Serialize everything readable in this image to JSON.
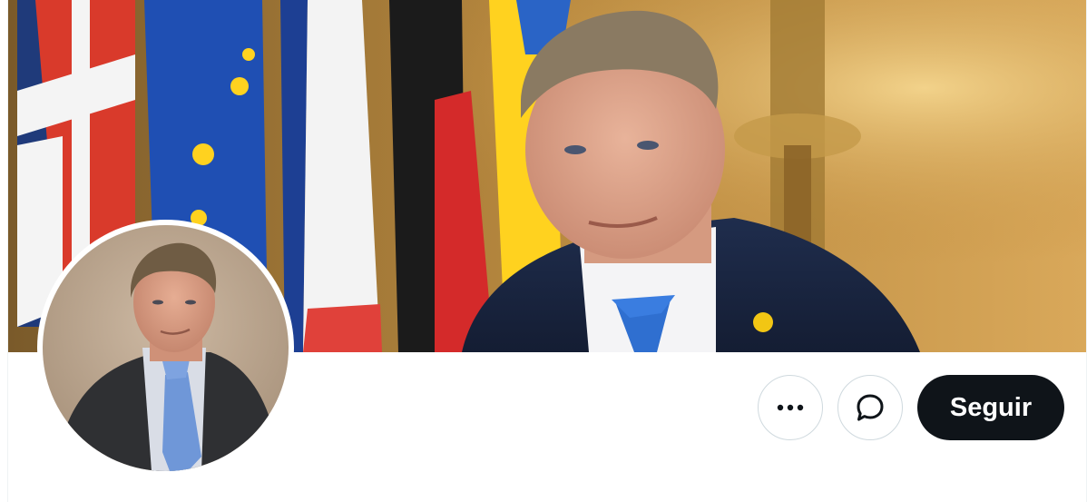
{
  "profile": {
    "banner_image": "photo-man-with-european-flags",
    "avatar_image": "portrait-man-in-suit"
  },
  "actions": {
    "more_icon": "more-dots-icon",
    "message_icon": "message-bubble-icon",
    "follow_label": "Seguir"
  },
  "colors": {
    "follow_bg": "#0f1419",
    "follow_text": "#ffffff",
    "button_border": "#cfd9de",
    "background": "#ffffff"
  }
}
